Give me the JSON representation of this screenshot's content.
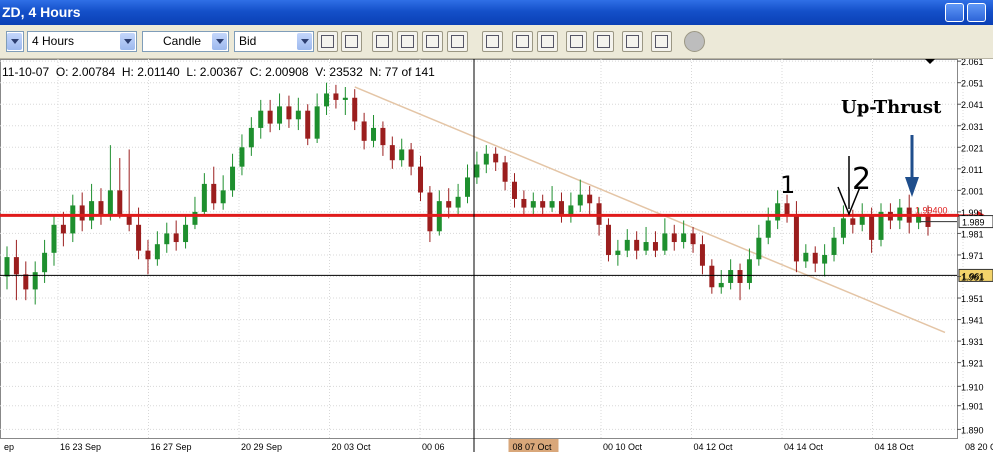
{
  "window": {
    "title": "ZD, 4 Hours"
  },
  "toolbar": {
    "timeframe": "4 Hours",
    "chart_type": "Candle",
    "price_type": "Bid"
  },
  "info_bar": {
    "date": "11-10-07",
    "open": "O: 2.00784",
    "high": "H: 2.01140",
    "low": "L: 2.00367",
    "close": "C: 2.00908",
    "volume": "V: 23532",
    "count": "N: 77 of 141"
  },
  "annotation": "Up-Thrust",
  "colors": {
    "bull": "#1e8f2e",
    "bear": "#9b1e1e",
    "support": "#e01b1b",
    "trend": "#e4c5a6",
    "title": "#1450c9"
  },
  "chart_data": {
    "type": "candlestick",
    "y_ticks": [
      "1.890",
      "1.901",
      "1.910",
      "1.921",
      "1.931",
      "1.941",
      "1.951",
      "1.961",
      "1.971",
      "1.981",
      "1.991",
      "2.001",
      "2.011",
      "2.021",
      "2.031",
      "2.041",
      "2.051",
      "2.061"
    ],
    "x_labels": [
      "ep",
      "16 23 Sep",
      "16 27 Sep",
      "20 29 Sep",
      "20 03 Oct",
      "00 06",
      "08 07 Oct",
      "00 10 Oct",
      "04 12 Oct",
      "04 14 Oct",
      "04 18 Oct",
      "08 20 Oct"
    ],
    "ylim": [
      1.886,
      2.062
    ],
    "horizontal_line": 1.9894,
    "horizontal_line_label": "1.99400",
    "current_price_label": "1.989",
    "crosshair_price_label": "1.961",
    "crosshair_price": 1.9615,
    "labels_on_chart": [
      "1",
      "2"
    ],
    "candles": [
      [
        1.961,
        1.97,
        1.975,
        1.955
      ],
      [
        1.97,
        1.962,
        1.978,
        1.95
      ],
      [
        1.962,
        1.955,
        1.968,
        1.95
      ],
      [
        1.955,
        1.963,
        1.968,
        1.948
      ],
      [
        1.963,
        1.972,
        1.978,
        1.958
      ],
      [
        1.972,
        1.985,
        1.99,
        1.966
      ],
      [
        1.985,
        1.981,
        1.991,
        1.975
      ],
      [
        1.981,
        1.994,
        1.999,
        1.977
      ],
      [
        1.994,
        1.987,
        2.0,
        1.982
      ],
      [
        1.987,
        1.996,
        2.004,
        1.983
      ],
      [
        1.996,
        1.989,
        2.002,
        1.985
      ],
      [
        1.989,
        2.001,
        2.022,
        1.987
      ],
      [
        2.001,
        1.99,
        2.016,
        1.988
      ],
      [
        1.99,
        1.985,
        2.02,
        1.982
      ],
      [
        1.985,
        1.973,
        1.993,
        1.969
      ],
      [
        1.973,
        1.969,
        1.978,
        1.962
      ],
      [
        1.969,
        1.976,
        1.982,
        1.966
      ],
      [
        1.976,
        1.981,
        1.986,
        1.972
      ],
      [
        1.981,
        1.977,
        1.987,
        1.973
      ],
      [
        1.977,
        1.985,
        1.99,
        1.974
      ],
      [
        1.985,
        1.991,
        1.998,
        1.983
      ],
      [
        1.991,
        2.004,
        2.009,
        1.989
      ],
      [
        2.004,
        1.995,
        2.012,
        1.992
      ],
      [
        1.995,
        2.001,
        2.008,
        1.992
      ],
      [
        2.001,
        2.012,
        2.018,
        1.998
      ],
      [
        2.012,
        2.021,
        2.027,
        2.008
      ],
      [
        2.021,
        2.03,
        2.035,
        2.017
      ],
      [
        2.03,
        2.038,
        2.043,
        2.025
      ],
      [
        2.038,
        2.032,
        2.043,
        2.028
      ],
      [
        2.032,
        2.04,
        2.046,
        2.029
      ],
      [
        2.04,
        2.034,
        2.045,
        2.03
      ],
      [
        2.034,
        2.038,
        2.044,
        2.029
      ],
      [
        2.038,
        2.025,
        2.041,
        2.022
      ],
      [
        2.025,
        2.04,
        2.046,
        2.023
      ],
      [
        2.04,
        2.046,
        2.051,
        2.036
      ],
      [
        2.046,
        2.043,
        2.05,
        2.039
      ],
      [
        2.043,
        2.044,
        2.049,
        2.036
      ],
      [
        2.044,
        2.033,
        2.048,
        2.029
      ],
      [
        2.033,
        2.024,
        2.037,
        2.02
      ],
      [
        2.024,
        2.03,
        2.036,
        2.021
      ],
      [
        2.03,
        2.022,
        2.033,
        2.017
      ],
      [
        2.022,
        2.015,
        2.026,
        2.011
      ],
      [
        2.015,
        2.02,
        2.025,
        2.012
      ],
      [
        2.02,
        2.012,
        2.023,
        2.008
      ],
      [
        2.012,
        2.0,
        2.017,
        1.996
      ],
      [
        2.0,
        1.982,
        2.003,
        1.977
      ],
      [
        1.982,
        1.996,
        2.001,
        1.98
      ],
      [
        1.996,
        1.993,
        2.002,
        1.988
      ],
      [
        1.993,
        1.998,
        2.004,
        1.99
      ],
      [
        1.998,
        2.007,
        2.013,
        1.995
      ],
      [
        2.007,
        2.013,
        2.019,
        2.004
      ],
      [
        2.013,
        2.018,
        2.022,
        2.009
      ],
      [
        2.018,
        2.014,
        2.021,
        2.01
      ],
      [
        2.014,
        2.005,
        2.017,
        2.001
      ],
      [
        2.005,
        1.997,
        2.009,
        1.993
      ],
      [
        1.997,
        1.993,
        2.001,
        1.99
      ],
      [
        1.993,
        1.996,
        2.0,
        1.99
      ],
      [
        1.996,
        1.993,
        1.999,
        1.989
      ],
      [
        1.993,
        1.996,
        2.003,
        1.991
      ],
      [
        1.996,
        1.989,
        2.0,
        1.986
      ],
      [
        1.989,
        1.994,
        2.0,
        1.986
      ],
      [
        1.994,
        1.999,
        2.006,
        1.991
      ],
      [
        1.999,
        1.995,
        2.003,
        1.99
      ],
      [
        1.995,
        1.985,
        1.998,
        1.98
      ],
      [
        1.985,
        1.971,
        1.988,
        1.968
      ],
      [
        1.971,
        1.973,
        1.978,
        1.966
      ],
      [
        1.973,
        1.978,
        1.983,
        1.97
      ],
      [
        1.978,
        1.973,
        1.982,
        1.969
      ],
      [
        1.973,
        1.977,
        1.984,
        1.971
      ],
      [
        1.977,
        1.973,
        1.982,
        1.97
      ],
      [
        1.973,
        1.981,
        1.988,
        1.971
      ],
      [
        1.981,
        1.977,
        1.985,
        1.973
      ],
      [
        1.977,
        1.981,
        1.987,
        1.974
      ],
      [
        1.981,
        1.976,
        1.984,
        1.972
      ],
      [
        1.976,
        1.966,
        1.98,
        1.962
      ],
      [
        1.966,
        1.956,
        1.969,
        1.953
      ],
      [
        1.956,
        1.958,
        1.964,
        1.953
      ],
      [
        1.958,
        1.964,
        1.969,
        1.955
      ],
      [
        1.964,
        1.958,
        1.967,
        1.95
      ],
      [
        1.958,
        1.969,
        1.974,
        1.955
      ],
      [
        1.969,
        1.979,
        1.985,
        1.966
      ],
      [
        1.979,
        1.987,
        1.993,
        1.976
      ],
      [
        1.987,
        1.995,
        2.001,
        1.983
      ],
      [
        1.995,
        1.99,
        1.999,
        1.986
      ],
      [
        1.99,
        1.968,
        1.996,
        1.963
      ],
      [
        1.968,
        1.972,
        1.976,
        1.965
      ],
      [
        1.972,
        1.967,
        1.975,
        1.963
      ],
      [
        1.967,
        1.971,
        1.976,
        1.961
      ],
      [
        1.971,
        1.979,
        1.984,
        1.968
      ],
      [
        1.979,
        1.988,
        1.994,
        1.976
      ],
      [
        1.988,
        1.985,
        1.992,
        1.981
      ],
      [
        1.985,
        1.99,
        1.995,
        1.982
      ],
      [
        1.99,
        1.978,
        1.993,
        1.972
      ],
      [
        1.978,
        1.991,
        1.995,
        1.975
      ],
      [
        1.991,
        1.987,
        1.995,
        1.983
      ],
      [
        1.987,
        1.993,
        1.997,
        1.983
      ],
      [
        1.993,
        1.986,
        1.999,
        1.981
      ],
      [
        1.986,
        1.99,
        1.993,
        1.983
      ],
      [
        1.99,
        1.984,
        1.994,
        1.98
      ]
    ]
  }
}
